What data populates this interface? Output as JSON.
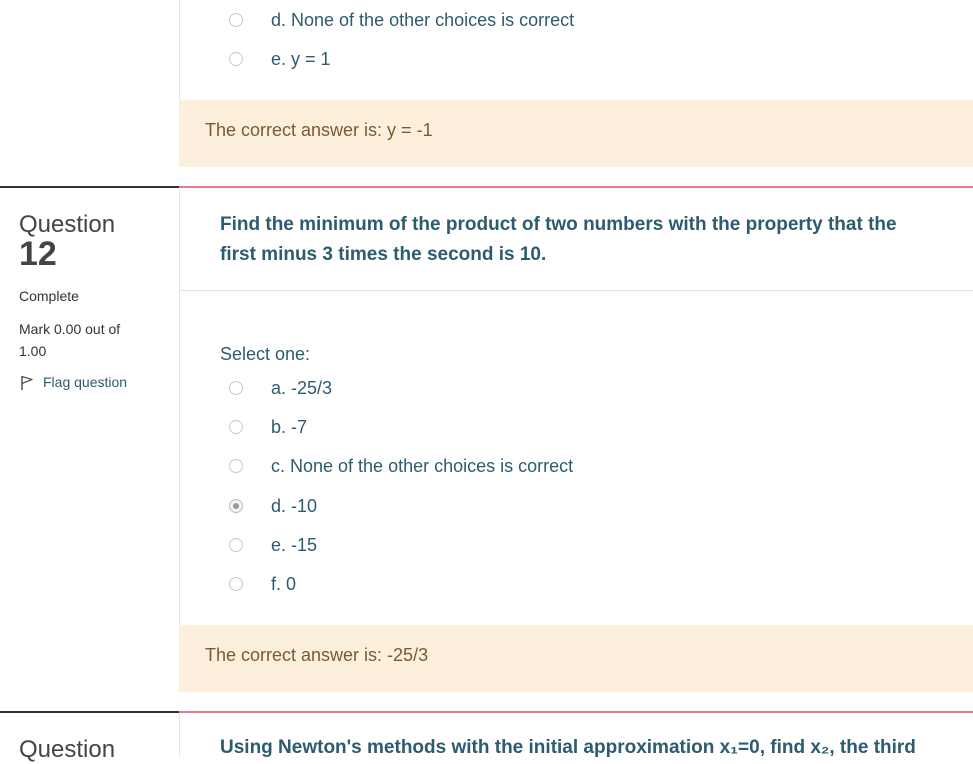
{
  "prev_question": {
    "options": [
      {
        "label": "d. None of the other choices is correct",
        "checked": false
      },
      {
        "label": "e. y = 1",
        "checked": false
      }
    ],
    "feedback": "The correct answer is: y = -1"
  },
  "question12": {
    "label": "Question",
    "number": "12",
    "status": "Complete",
    "mark_line1": "Mark 0.00 out of",
    "mark_line2": "1.00",
    "flag_label": "Flag question",
    "text_line1": "Find the minimum of the product of two numbers with the property that the",
    "text_line2": "first minus 3 times the second is 10.",
    "prompt": "Select one:",
    "options": [
      {
        "label": "a. -25/3",
        "checked": false
      },
      {
        "label": "b. -7",
        "checked": false
      },
      {
        "label": "c. None of the other choices is correct",
        "checked": false
      },
      {
        "label": "d. -10",
        "checked": true
      },
      {
        "label": "e. -15",
        "checked": false
      },
      {
        "label": "f. 0",
        "checked": false
      }
    ],
    "feedback": "The correct answer is: -25/3"
  },
  "next_question": {
    "label": "Question",
    "text_partial": "Using Newton's methods with the initial approximation x₁=0, find x₂, the third"
  },
  "colors": {
    "question_text": "#2d5b6f",
    "feedback_bg": "#fcefdc",
    "separator_pink": "#e8788a"
  }
}
